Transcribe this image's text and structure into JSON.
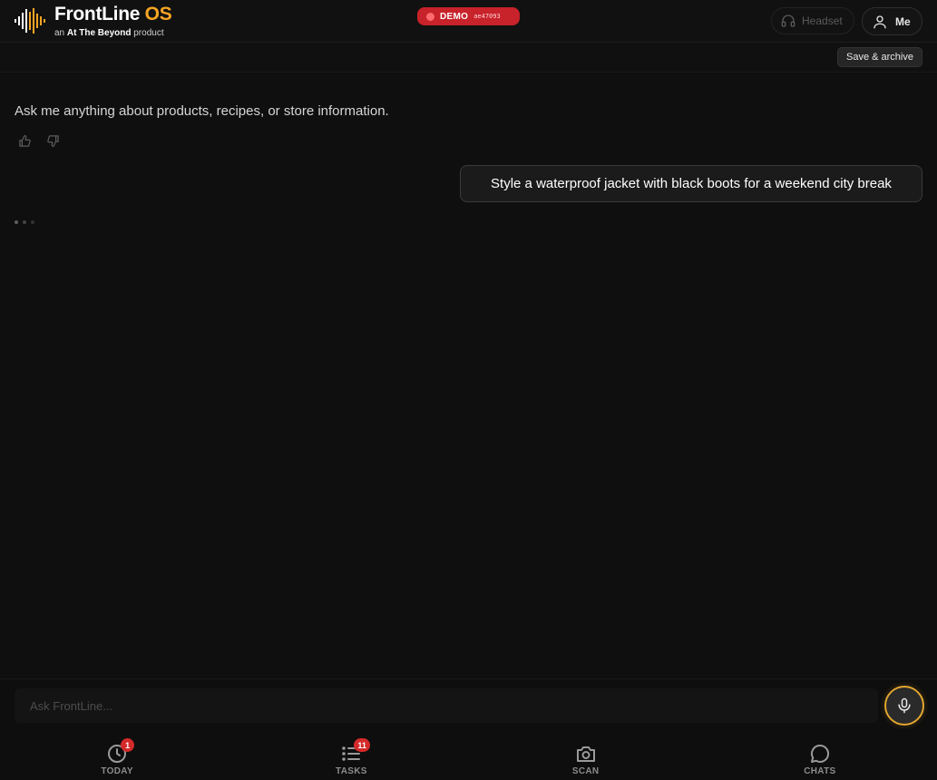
{
  "header": {
    "brand_name": "FrontLine",
    "brand_suffix": "OS",
    "byline_prefix": "an",
    "byline_company": "At The Beyond",
    "byline_suffix": "product",
    "demo_label": "DEMO",
    "demo_code": "ae47093",
    "headset_label": "Headset",
    "me_label": "Me",
    "icons": [
      "soundwave-logo-icon",
      "headset-icon",
      "user-icon"
    ]
  },
  "toolbar": {
    "save_archive_label": "Save & archive"
  },
  "conversation": {
    "assistant_message": "Ask me anything about products, recipes, or store information.",
    "user_message": "Style a waterproof jacket with black boots for a weekend city break",
    "feedback_icons": [
      "thumbs-up-icon",
      "thumbs-down-icon"
    ]
  },
  "composer": {
    "placeholder": "Ask FrontLine...",
    "value": "",
    "mic_icon": "microphone-icon"
  },
  "nav": {
    "items": [
      {
        "label": "TODAY",
        "icon": "clock-icon",
        "badge": "1"
      },
      {
        "label": "TASKS",
        "icon": "list-icon",
        "badge": "11"
      },
      {
        "label": "SCAN",
        "icon": "camera-icon",
        "badge": ""
      },
      {
        "label": "CHATS",
        "icon": "chat-bubble-icon",
        "badge": ""
      }
    ]
  },
  "colors": {
    "accent": "#f5a524",
    "demo_badge": "#c8222a",
    "nav_badge": "#d42a2a",
    "background": "#0f0f0f"
  }
}
